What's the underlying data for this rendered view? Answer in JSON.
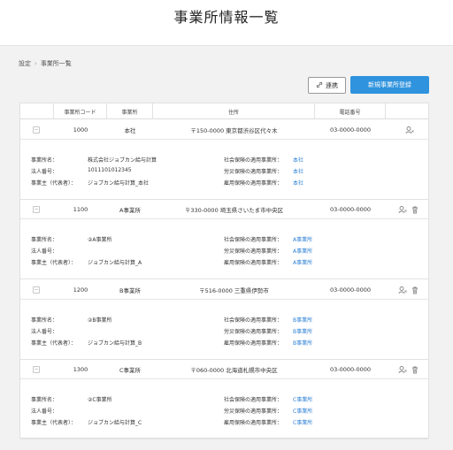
{
  "page": {
    "title": "事業所情報一覧"
  },
  "breadcrumb": {
    "parent": "設定",
    "sep": "›",
    "current": "事業所一覧"
  },
  "toolbar": {
    "link_label": "連携",
    "new_label": "新規事業所登録"
  },
  "table": {
    "headers": [
      "事業所コード",
      "事業所",
      "住所",
      "電話番号"
    ],
    "detail_labels": {
      "office_name": "事業所名：",
      "corp_number": "法人番号：",
      "owner": "事業主（代表者）：",
      "social": "社会保険の適用事業所：",
      "labor": "労災保険の適用事業所：",
      "employment": "雇用保険の適用事業所："
    },
    "offices": [
      {
        "code": "1000",
        "name": "本社",
        "address": "〒150-0000 東京都渋谷区代々木",
        "phone": "03-0000-0000",
        "office_name": "株式会社ジョブカン給与計算",
        "corp_number": "1011101012345",
        "owner": "ジョブカン給与計算_本社",
        "social": "本社",
        "labor": "本社",
        "employment": "本社"
      },
      {
        "code": "1100",
        "name": "A事業所",
        "address": "〒330-0000 埼玉県さいたま市中央区",
        "phone": "03-0000-0000",
        "office_name": "②A事業所",
        "corp_number": "",
        "owner": "ジョブカン給与計算_A",
        "social": "A事業所",
        "labor": "A事業所",
        "employment": "A事業所"
      },
      {
        "code": "1200",
        "name": "B事業所",
        "address": "〒516-0000 三重県伊勢市",
        "phone": "03-0000-0000",
        "office_name": "②B事業所",
        "corp_number": "",
        "owner": "ジョブカン給与計算_B",
        "social": "B事業所",
        "labor": "B事業所",
        "employment": "B事業所"
      },
      {
        "code": "1300",
        "name": "C事業所",
        "address": "〒060-0000 北海道札幌市中央区",
        "phone": "03-0000-0000",
        "office_name": "②C事業所",
        "corp_number": "",
        "owner": "ジョブカン給与計算_C",
        "social": "C事業所",
        "labor": "C事業所",
        "employment": "C事業所"
      }
    ]
  },
  "icons": {
    "link": "link-icon",
    "user": "user-settings-icon",
    "trash": "trash-icon",
    "toggle": "collapse-icon"
  },
  "colors": {
    "accent": "#2f93dd",
    "link": "#2a7fd4"
  }
}
